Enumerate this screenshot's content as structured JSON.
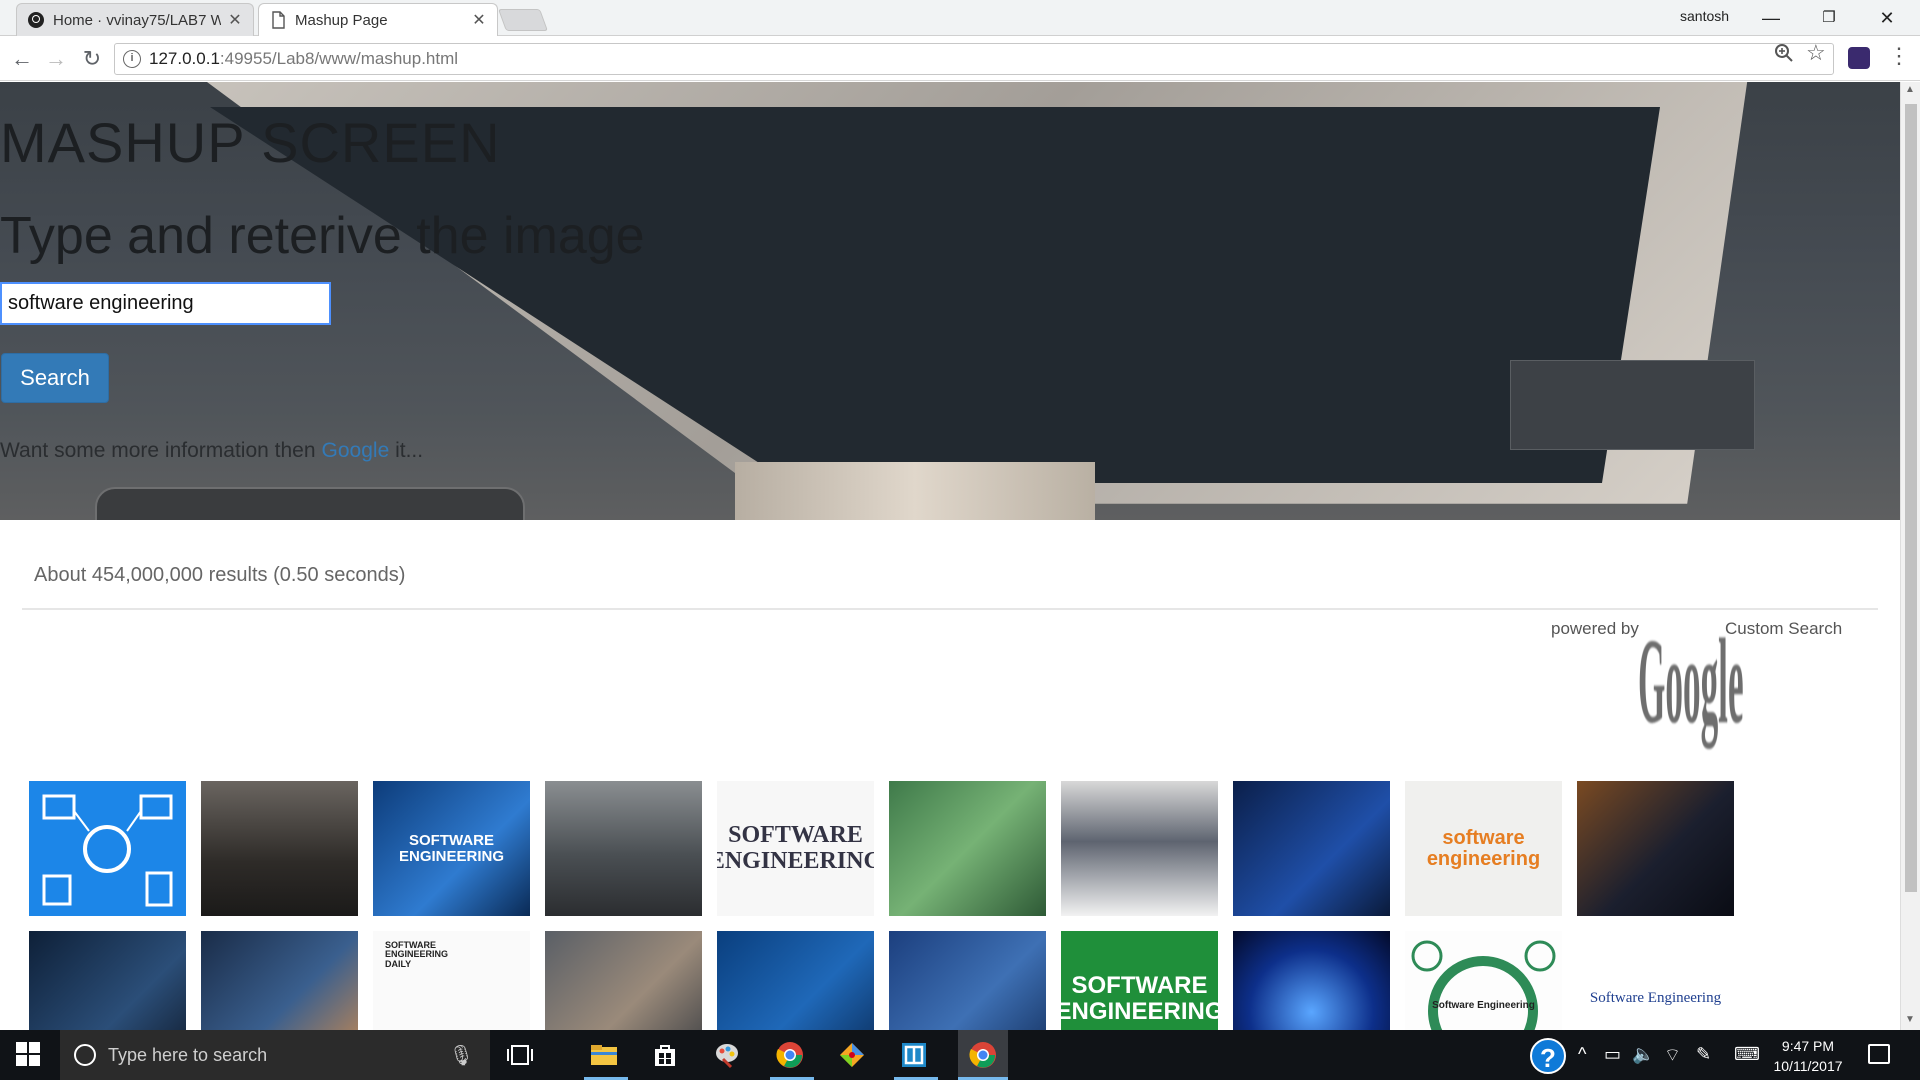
{
  "browser": {
    "tabs": [
      {
        "label": "Home · vvinay75/LAB7 W",
        "active": false
      },
      {
        "label": "Mashup Page",
        "active": true
      }
    ],
    "profile": "santosh",
    "url_host": "127.0.0.1",
    "url_path": ":49955/Lab8/www/mashup.html"
  },
  "hero": {
    "title": "MASHUP SCREEN",
    "subtitle": "Type and reterive the image",
    "search_value": "software engineering",
    "search_button": "Search",
    "more_info_text": "Want some more information then",
    "more_info_link": "Google",
    "more_info_tail": "it..."
  },
  "results": {
    "info": "About 454,000,000 results (0.50 seconds)",
    "powered_by": "powered by",
    "google_logo": "Google",
    "custom_search": "Custom Search",
    "thumbnail_captions": {
      "t3": "SOFTWARE ENGINEERING",
      "t5": "SOFTWARE ENGINEERING",
      "t9": "software engineering",
      "t13": "SOFTWARE ENGINEERING DAILY",
      "t17": "SOFTWARE ENGINEERING",
      "t19": "Software Engineering",
      "t20": "Software Engineering"
    }
  },
  "taskbar": {
    "search_placeholder": "Type here to search",
    "time": "9:47 PM",
    "date": "10/11/2017"
  },
  "colors": {
    "accent": "#337ab7",
    "input_border": "#4d90fe",
    "taskbar": "#101317"
  }
}
